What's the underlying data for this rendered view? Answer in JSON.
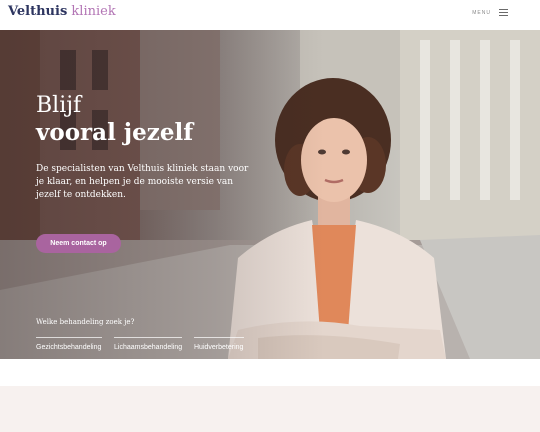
{
  "header": {
    "logo_brand": "Velthuis",
    "logo_sub": "kliniek",
    "menu_label": "MENU"
  },
  "hero": {
    "title_line1": "Blijf",
    "title_line2": "vooral jezelf",
    "text": "De specialisten van Velthuis kliniek staan voor je klaar, en helpen je de mooiste versie van jezelf te ontdekken.",
    "cta_label": "Neem contact op",
    "question": "Welke behandeling zoek je?",
    "categories": [
      "Gezichtsbehandeling",
      "Lichaamsbehandeling",
      "Huidverbetering"
    ]
  },
  "colors": {
    "brand_navy": "#2d3560",
    "brand_purple": "#b274b4",
    "cta": "#a9649f",
    "section_beige": "#f7f1ef"
  },
  "icons": {
    "menu": "hamburger-icon"
  }
}
